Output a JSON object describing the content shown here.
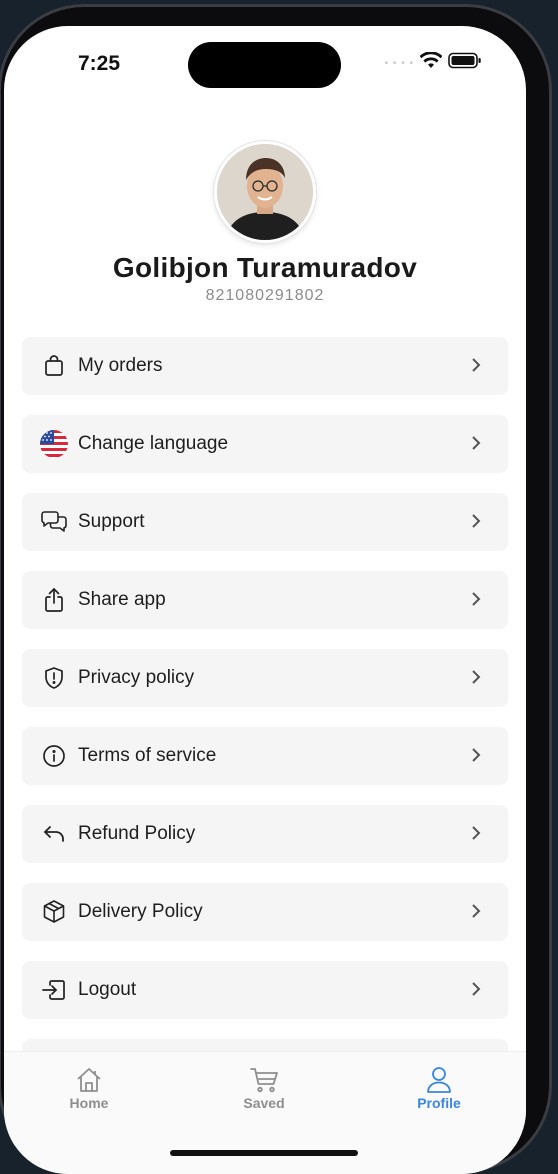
{
  "status_bar": {
    "time": "7:25",
    "signal_dots": "• • • •"
  },
  "profile": {
    "name": "Golibjon Turamuradov",
    "phone": "821080291802"
  },
  "menu": [
    {
      "label": "My orders",
      "icon": "shopping-bag-icon"
    },
    {
      "label": "Change language",
      "icon": "us-flag-icon"
    },
    {
      "label": "Support",
      "icon": "chat-bubbles-icon"
    },
    {
      "label": "Share app",
      "icon": "share-icon"
    },
    {
      "label": "Privacy policy",
      "icon": "shield-alert-icon"
    },
    {
      "label": "Terms of service",
      "icon": "info-icon"
    },
    {
      "label": "Refund Policy",
      "icon": "undo-arrow-icon"
    },
    {
      "label": "Delivery Policy",
      "icon": "package-icon"
    },
    {
      "label": "Logout",
      "icon": "logout-icon"
    }
  ],
  "tabs": [
    {
      "label": "Home",
      "icon": "home-icon",
      "active": false
    },
    {
      "label": "Saved",
      "icon": "cart-icon",
      "active": false
    },
    {
      "label": "Profile",
      "icon": "user-icon",
      "active": true
    }
  ],
  "colors": {
    "accent": "#3a86e0",
    "item_bg": "#f5f5f5",
    "text": "#1e1e1e",
    "muted": "#8c8c8c"
  }
}
